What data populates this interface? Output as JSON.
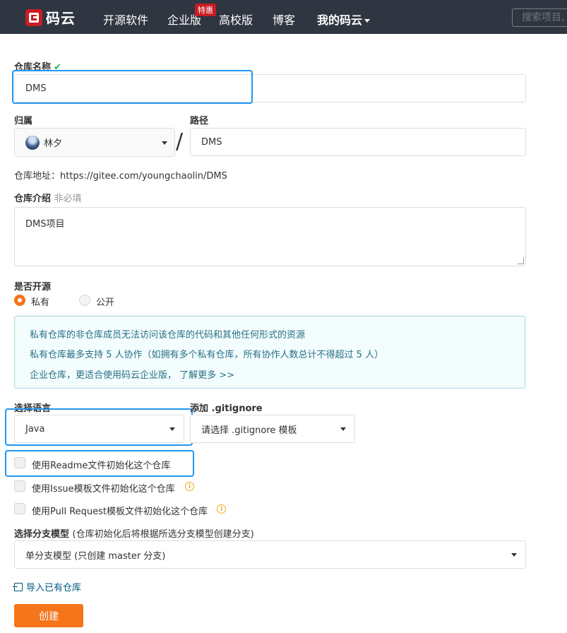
{
  "nav": {
    "logo_text": "码云",
    "items": [
      "开源软件",
      "企业版",
      "高校版",
      "博客",
      "我的码云"
    ],
    "badge": "特惠",
    "search_placeholder": "搜索项目,"
  },
  "form": {
    "repo_name_label": "仓库名称",
    "repo_name_value": "DMS",
    "owner_label": "归属",
    "owner_value": "林夕",
    "path_label": "路径",
    "path_value": "DMS",
    "repo_address": "仓库地址：https://gitee.com/youngchaolin/DMS",
    "intro_label": "仓库介绍",
    "intro_optional": "非必填",
    "intro_value": "DMS项目",
    "visibility_label": "是否开源",
    "visibility_options": [
      "私有",
      "公开"
    ],
    "visibility_selected": "私有",
    "info_lines": [
      "私有仓库的非仓库成员无法访问该仓库的代码和其他任何形式的资源",
      "私有仓库最多支持 5 人协作（如拥有多个私有仓库，所有协作人数总计不得超过 5 人）",
      "企业仓库，更适合使用码云企业版，  了解更多 >>"
    ],
    "language_label": "选择语言",
    "language_value": "Java",
    "gitignore_label": "添加 .gitignore",
    "gitignore_placeholder": "请选择 .gitignore 模板",
    "checkboxes": [
      "使用Readme文件初始化这个仓库",
      "使用Issue模板文件初始化这个仓库",
      "使用Pull Request模板文件初始化这个仓库"
    ],
    "branch_label": "选择分支模型",
    "branch_hint": "(仓库初始化后将根据所选分支模型创建分支)",
    "branch_value": "单分支模型 (只创建 master 分支)",
    "import_link": "导入已有仓库",
    "create_button": "创建"
  },
  "colors": {
    "nav_bg": "#2f3541",
    "accent": "#f5751a",
    "brand_red": "#c71d23",
    "highlight": "#2196f3",
    "info_text": "#276f86"
  }
}
